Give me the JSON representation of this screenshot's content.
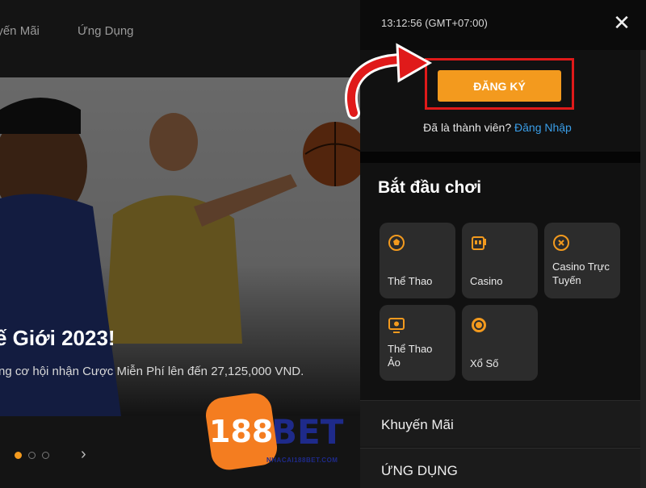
{
  "nav": {
    "promotions": "uyến Mãi",
    "apps": "Ứng Dụng"
  },
  "hero": {
    "title": "ế Giới 2023!",
    "subtitle": "ng cơ hội nhận Cược Miễn Phí lên đến 27,125,000 VND.",
    "dots": 3,
    "active_dot": 0
  },
  "logo": {
    "number": "188",
    "word": "BET",
    "domain": "NHACAI188BET.COM"
  },
  "panel": {
    "clock": "13:12:56 (GMT+07:00)",
    "register_label": "ĐĂNG KÝ",
    "member_question": "Đã là thành viên?",
    "login_label": "Đăng Nhập",
    "start_heading": "Bắt đầu chơi",
    "tiles": [
      {
        "label": "Thể Thao",
        "icon": "soccer-ball-icon"
      },
      {
        "label": "Casino",
        "icon": "slot-machine-icon"
      },
      {
        "label_line1": "Casino Trực",
        "label_line2": "Tuyến",
        "icon": "poker-chip-icon"
      },
      {
        "label_line1": "Thể Thao",
        "label_line2": "Ảo",
        "icon": "virtual-sports-icon"
      },
      {
        "label": "Xổ Số",
        "icon": "lottery-ball-icon"
      }
    ],
    "menu_promotions": "Khuyến Mãi",
    "menu_apps": "ỨNG DỤNG"
  },
  "colors": {
    "accent": "#f39a1e",
    "highlight": "#e01a1a",
    "link": "#3a9ee8",
    "tile": "#2c2c2c"
  }
}
